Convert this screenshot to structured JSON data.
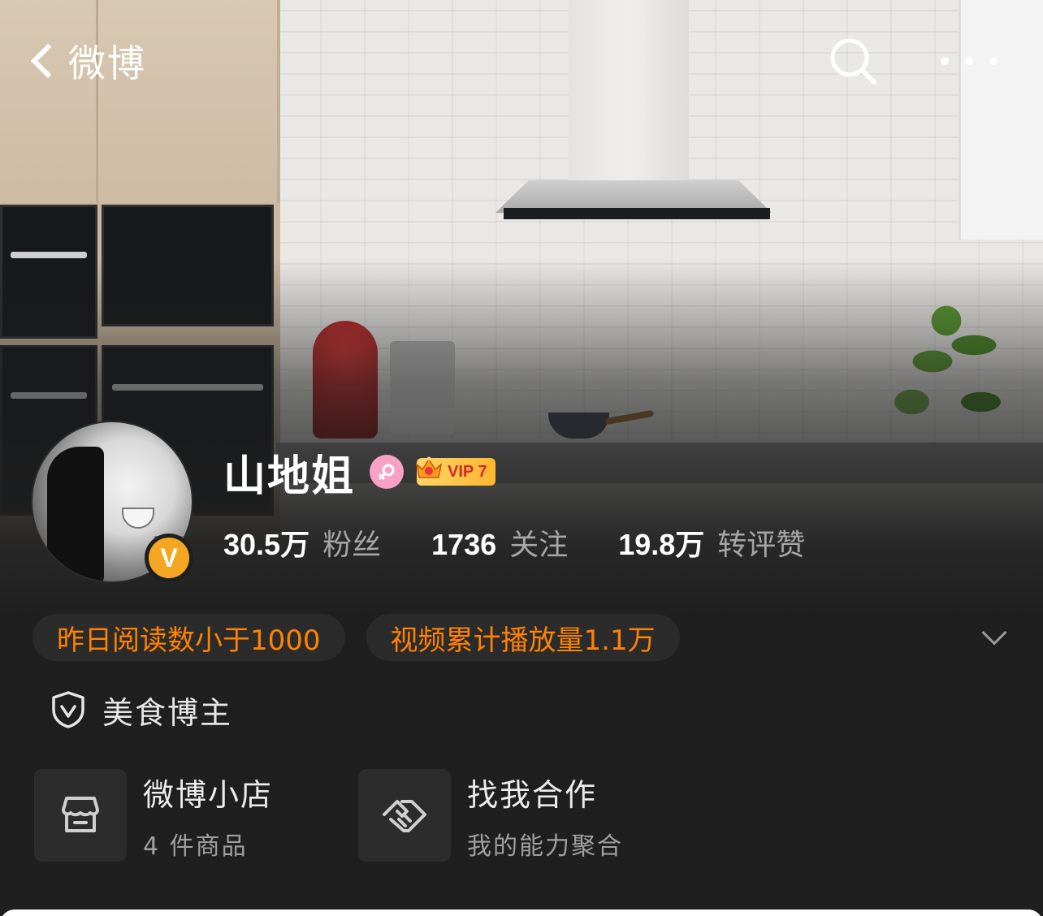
{
  "nav": {
    "back_label": "微博"
  },
  "profile": {
    "name": "山地姐",
    "vip_label": "VIP 7",
    "verified_mark": "V"
  },
  "stats": [
    {
      "value": "30.5万",
      "label": "粉丝"
    },
    {
      "value": "1736",
      "label": "关注"
    },
    {
      "value": "19.8万",
      "label": "转评赞"
    }
  ],
  "tags": [
    "昨日阅读数小于1000",
    "视频累计播放量1.1万"
  ],
  "certification": {
    "label": "美食博主"
  },
  "services": [
    {
      "title": "微博小店",
      "subtitle": "4 件商品",
      "icon": "shop-icon"
    },
    {
      "title": "找我合作",
      "subtitle": "我的能力聚合",
      "icon": "handshake-icon"
    }
  ],
  "colors": {
    "background": "#1f1f1f",
    "accent_orange": "#ff8200",
    "verified_badge": "#f5a623",
    "female_badge": "#f7a1c4",
    "vip_gold": "#ffc34a"
  }
}
